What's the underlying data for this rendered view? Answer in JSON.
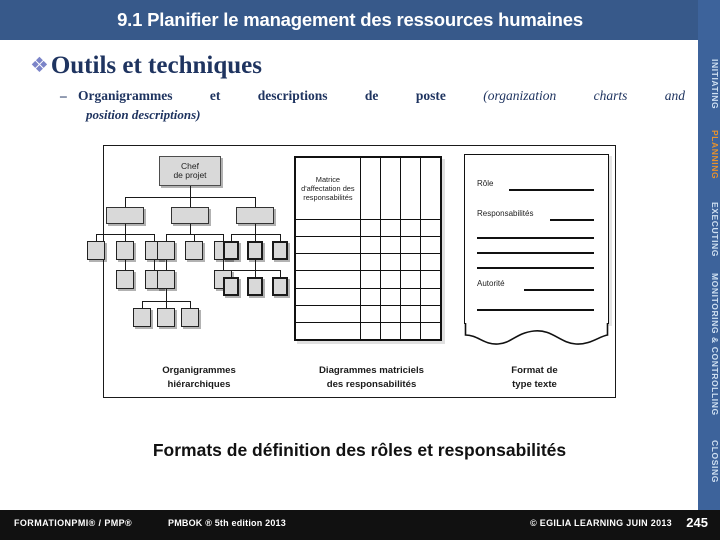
{
  "title": {
    "text": "9.1 Planifier le management des ressources humaines",
    "bar_color": "#37598a"
  },
  "rail": {
    "background": "#3d639b",
    "active_color": "#e8922c",
    "inactive_color": "#cfe0f2",
    "items": [
      {
        "label": "INITIATING",
        "active": false
      },
      {
        "label": "PLANNING",
        "active": true
      },
      {
        "label": "EXECUTING",
        "active": false
      },
      {
        "label": "MONITORING & CONTROLLING",
        "active": false
      },
      {
        "label": "CLOSING",
        "active": false
      }
    ]
  },
  "heading": {
    "bullet_glyph": "❖",
    "text": "Outils et techniques",
    "color": "#1f3460"
  },
  "bullet": {
    "dash": "–",
    "words": [
      "Organigrammes",
      "et",
      "descriptions",
      "de",
      "poste"
    ],
    "italic_words": [
      "(organization",
      "charts",
      "and"
    ],
    "line2": "position descriptions)"
  },
  "figure": {
    "org_chart": {
      "root_label_line1": "Chef",
      "root_label_line2": "de projet"
    },
    "matrix": {
      "header_line1": "Matrice",
      "header_line2": "d'affectation des",
      "header_line3": "responsabilités",
      "rows": 8,
      "cols": 5
    },
    "text_doc": {
      "labels": [
        "Rôle",
        "Responsabilités",
        "Autorité"
      ]
    },
    "captions": [
      {
        "line1": "Organigrammes",
        "line2": "hiérarchiques"
      },
      {
        "line1": "Diagrammes matriciels",
        "line2": "des responsabilités"
      },
      {
        "line1": "Format de",
        "line2": "type texte"
      }
    ],
    "main_caption": "Formats de définition des rôles et responsabilités"
  },
  "footer": {
    "background": "#111111",
    "left": "FORMATIONPMI® / PMP®",
    "middle": "PMBOK ® 5th edition  2013",
    "right": "© EGILIA LEARNING  JUIN 2013",
    "page": "245"
  }
}
